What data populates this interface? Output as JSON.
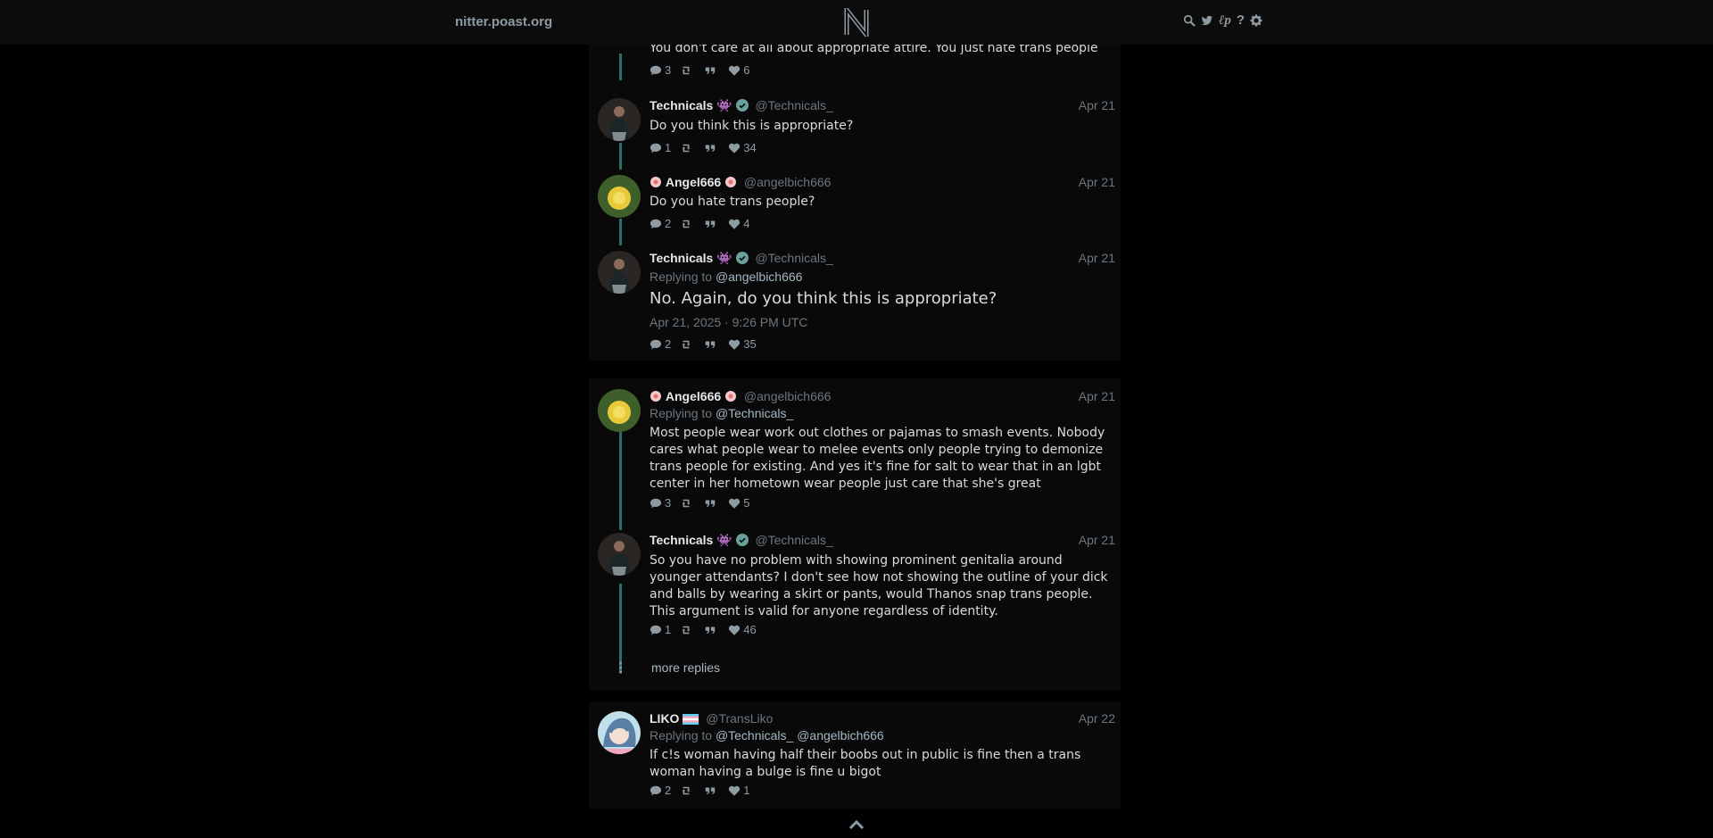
{
  "nav": {
    "site_name": "nitter.poast.org",
    "logo_letter": "N"
  },
  "tweets": [
    {
      "content": "You don't care at all about appropriate attire. You just hate trans people",
      "stats": {
        "replies": "3",
        "retweets": "",
        "quotes": "",
        "likes": "6"
      }
    },
    {
      "fullname": "Technicals 👾",
      "username": "@Technicals_",
      "date": "Apr 21",
      "content": "Do you think this is appropriate?",
      "stats": {
        "replies": "1",
        "retweets": "",
        "quotes": "",
        "likes": "34"
      }
    },
    {
      "fullname": "Angel666",
      "username": "@angelbich666",
      "date": "Apr 21",
      "content": "Do you hate trans people?",
      "stats": {
        "replies": "2",
        "retweets": "",
        "quotes": "",
        "likes": "4"
      }
    },
    {
      "fullname": "Technicals 👾",
      "username": "@Technicals_",
      "date": "Apr 21",
      "replying_label": "Replying to",
      "replying_to": [
        "@angelbich666"
      ],
      "content": "No. Again, do you think this is appropriate?",
      "published": "Apr 21, 2025 · 9:26 PM UTC",
      "stats": {
        "replies": "2",
        "retweets": "",
        "quotes": "",
        "likes": "35"
      }
    },
    {
      "fullname": "Angel666",
      "username": "@angelbich666",
      "date": "Apr 21",
      "replying_label": "Replying to",
      "replying_to": [
        "@Technicals_"
      ],
      "content": "Most people wear work out  clothes or pajamas to smash events. Nobody cares what people wear to melee events only people trying to demonize trans people for existing. And yes it's fine for salt to wear that in an lgbt center in her hometown wear people just care that she's great",
      "stats": {
        "replies": "3",
        "retweets": "",
        "quotes": "",
        "likes": "5"
      }
    },
    {
      "fullname": "Technicals 👾",
      "username": "@Technicals_",
      "date": "Apr 21",
      "content": "So you have no problem with showing prominent genitalia around younger attendants? I don't see how not showing the outline of your dick and balls by wearing a skirt or pants, would Thanos snap trans people. This argument is valid for anyone regardless of identity.",
      "stats": {
        "replies": "1",
        "retweets": "",
        "quotes": "",
        "likes": "46"
      }
    },
    {
      "fullname": "LIKO",
      "username": "@TransLiko",
      "date": "Apr 22",
      "replying_label": "Replying to",
      "replying_to": [
        "@Technicals_",
        "@angelbich666"
      ],
      "content": "If c!s woman having half their boobs out in public is fine then a trans woman having a bulge is fine u bigot",
      "stats": {
        "replies": "2",
        "retweets": "",
        "quotes": "",
        "likes": "1"
      }
    }
  ],
  "more_replies": "more replies",
  "colors": {
    "accent_line": "#2b6f6a",
    "link": "#a6b8c2",
    "muted": "#6b7780"
  },
  "icons": [
    "search-icon",
    "twitter-bird-icon",
    "rss-icon",
    "help-icon",
    "gear-icon",
    "comment-icon",
    "retweet-icon",
    "quote-icon",
    "heart-icon",
    "verified-icon",
    "chevron-up-icon"
  ]
}
